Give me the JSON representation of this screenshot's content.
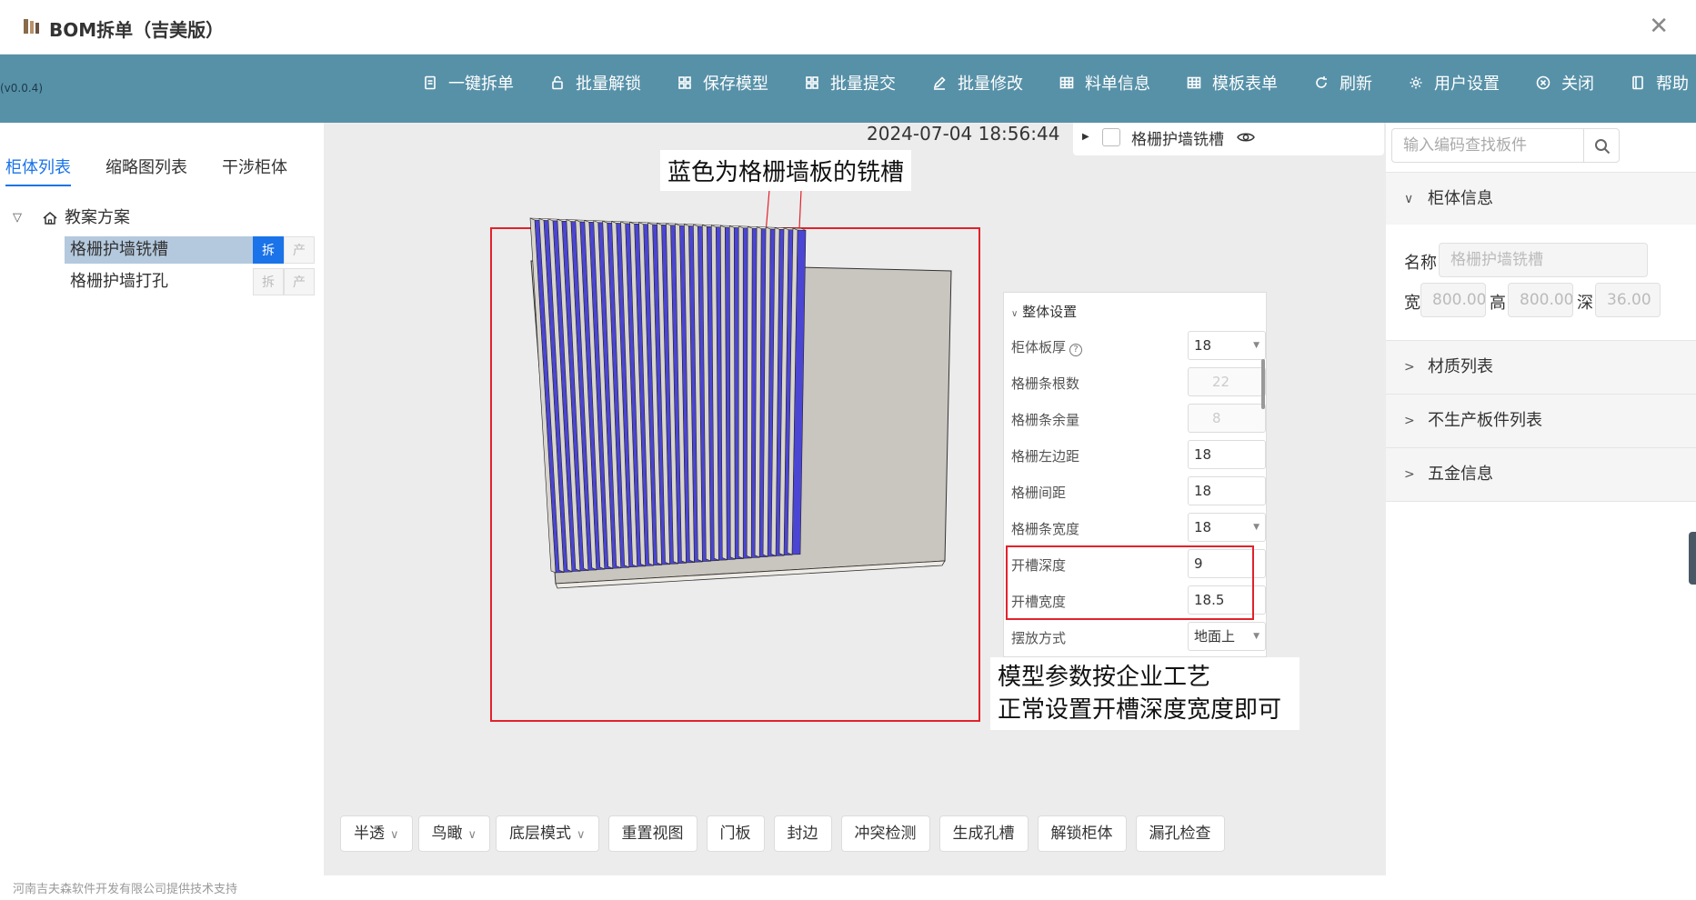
{
  "app": {
    "title": "BOM拆单（吉美版）",
    "version": "(v0.0.4)",
    "close_icon": "close-icon"
  },
  "toolbar": [
    {
      "label": "一键拆单",
      "icon": "document-icon"
    },
    {
      "label": "批量解锁",
      "icon": "lock-icon"
    },
    {
      "label": "保存模型",
      "icon": "grid-icon"
    },
    {
      "label": "批量提交",
      "icon": "grid-icon"
    },
    {
      "label": "批量修改",
      "icon": "edit-icon"
    },
    {
      "label": "料单信息",
      "icon": "table-icon"
    },
    {
      "label": "模板表单",
      "icon": "table-icon"
    },
    {
      "label": "刷新",
      "icon": "refresh-icon"
    },
    {
      "label": "用户设置",
      "icon": "gear-icon"
    },
    {
      "label": "关闭",
      "icon": "close-circle-icon"
    },
    {
      "label": "帮助",
      "icon": "book-icon"
    }
  ],
  "left": {
    "tabs": [
      "柜体列表",
      "缩略图列表",
      "干涉柜体"
    ],
    "tree": {
      "root": "教案方案",
      "items": [
        {
          "label": "格栅护墙铣槽",
          "btn1": "拆",
          "btn2": "产",
          "selected": true
        },
        {
          "label": "格栅护墙打孔",
          "btn1": "拆",
          "btn2": "产",
          "selected": false
        }
      ]
    },
    "footer": "河南吉夫森软件开发有限公司提供技术支持"
  },
  "canvas": {
    "timestamp": "2024-07-04 18:56:44",
    "layer_label": "格栅护墙铣槽",
    "annotation_top": "蓝色为格栅墙板的铣槽",
    "annotation_bottom_1": "模型参数按企业工艺",
    "annotation_bottom_2": "正常设置开槽深度宽度即可",
    "colors": {
      "slot": "#4b45d4",
      "board": "#d8d4ce",
      "highlight": "#e2222c",
      "toolbar": "#5791a8"
    }
  },
  "settings": {
    "header": "整体设置",
    "rows": [
      {
        "label": "柜体板厚",
        "value": "18"
      },
      {
        "label": "格栅条根数",
        "value": "22"
      },
      {
        "label": "格栅条余量",
        "value": "8"
      },
      {
        "label": "格栅左边距",
        "value": "18"
      },
      {
        "label": "格栅间距",
        "value": "18"
      },
      {
        "label": "格栅条宽度",
        "value": "18"
      },
      {
        "label": "开槽深度",
        "value": "9"
      },
      {
        "label": "开槽宽度",
        "value": "18.5"
      },
      {
        "label": "摆放方式",
        "value": "地面上"
      }
    ]
  },
  "bottom_buttons": [
    "半透",
    "鸟瞰",
    "底层模式",
    "重置视图",
    "门板",
    "封边",
    "冲突检测",
    "生成孔槽",
    "解锁柜体",
    "漏孔检查"
  ],
  "right": {
    "search_placeholder": "输入编码查找板件",
    "sections": [
      "柜体信息",
      "材质列表",
      "不生产板件列表",
      "五金信息"
    ],
    "info": {
      "name_label": "名称",
      "name_value": "格栅护墙铣槽",
      "w_label": "宽",
      "w_value": "800.00",
      "h_label": "高",
      "h_value": "800.00",
      "d_label": "深",
      "d_value": "36.00"
    }
  }
}
